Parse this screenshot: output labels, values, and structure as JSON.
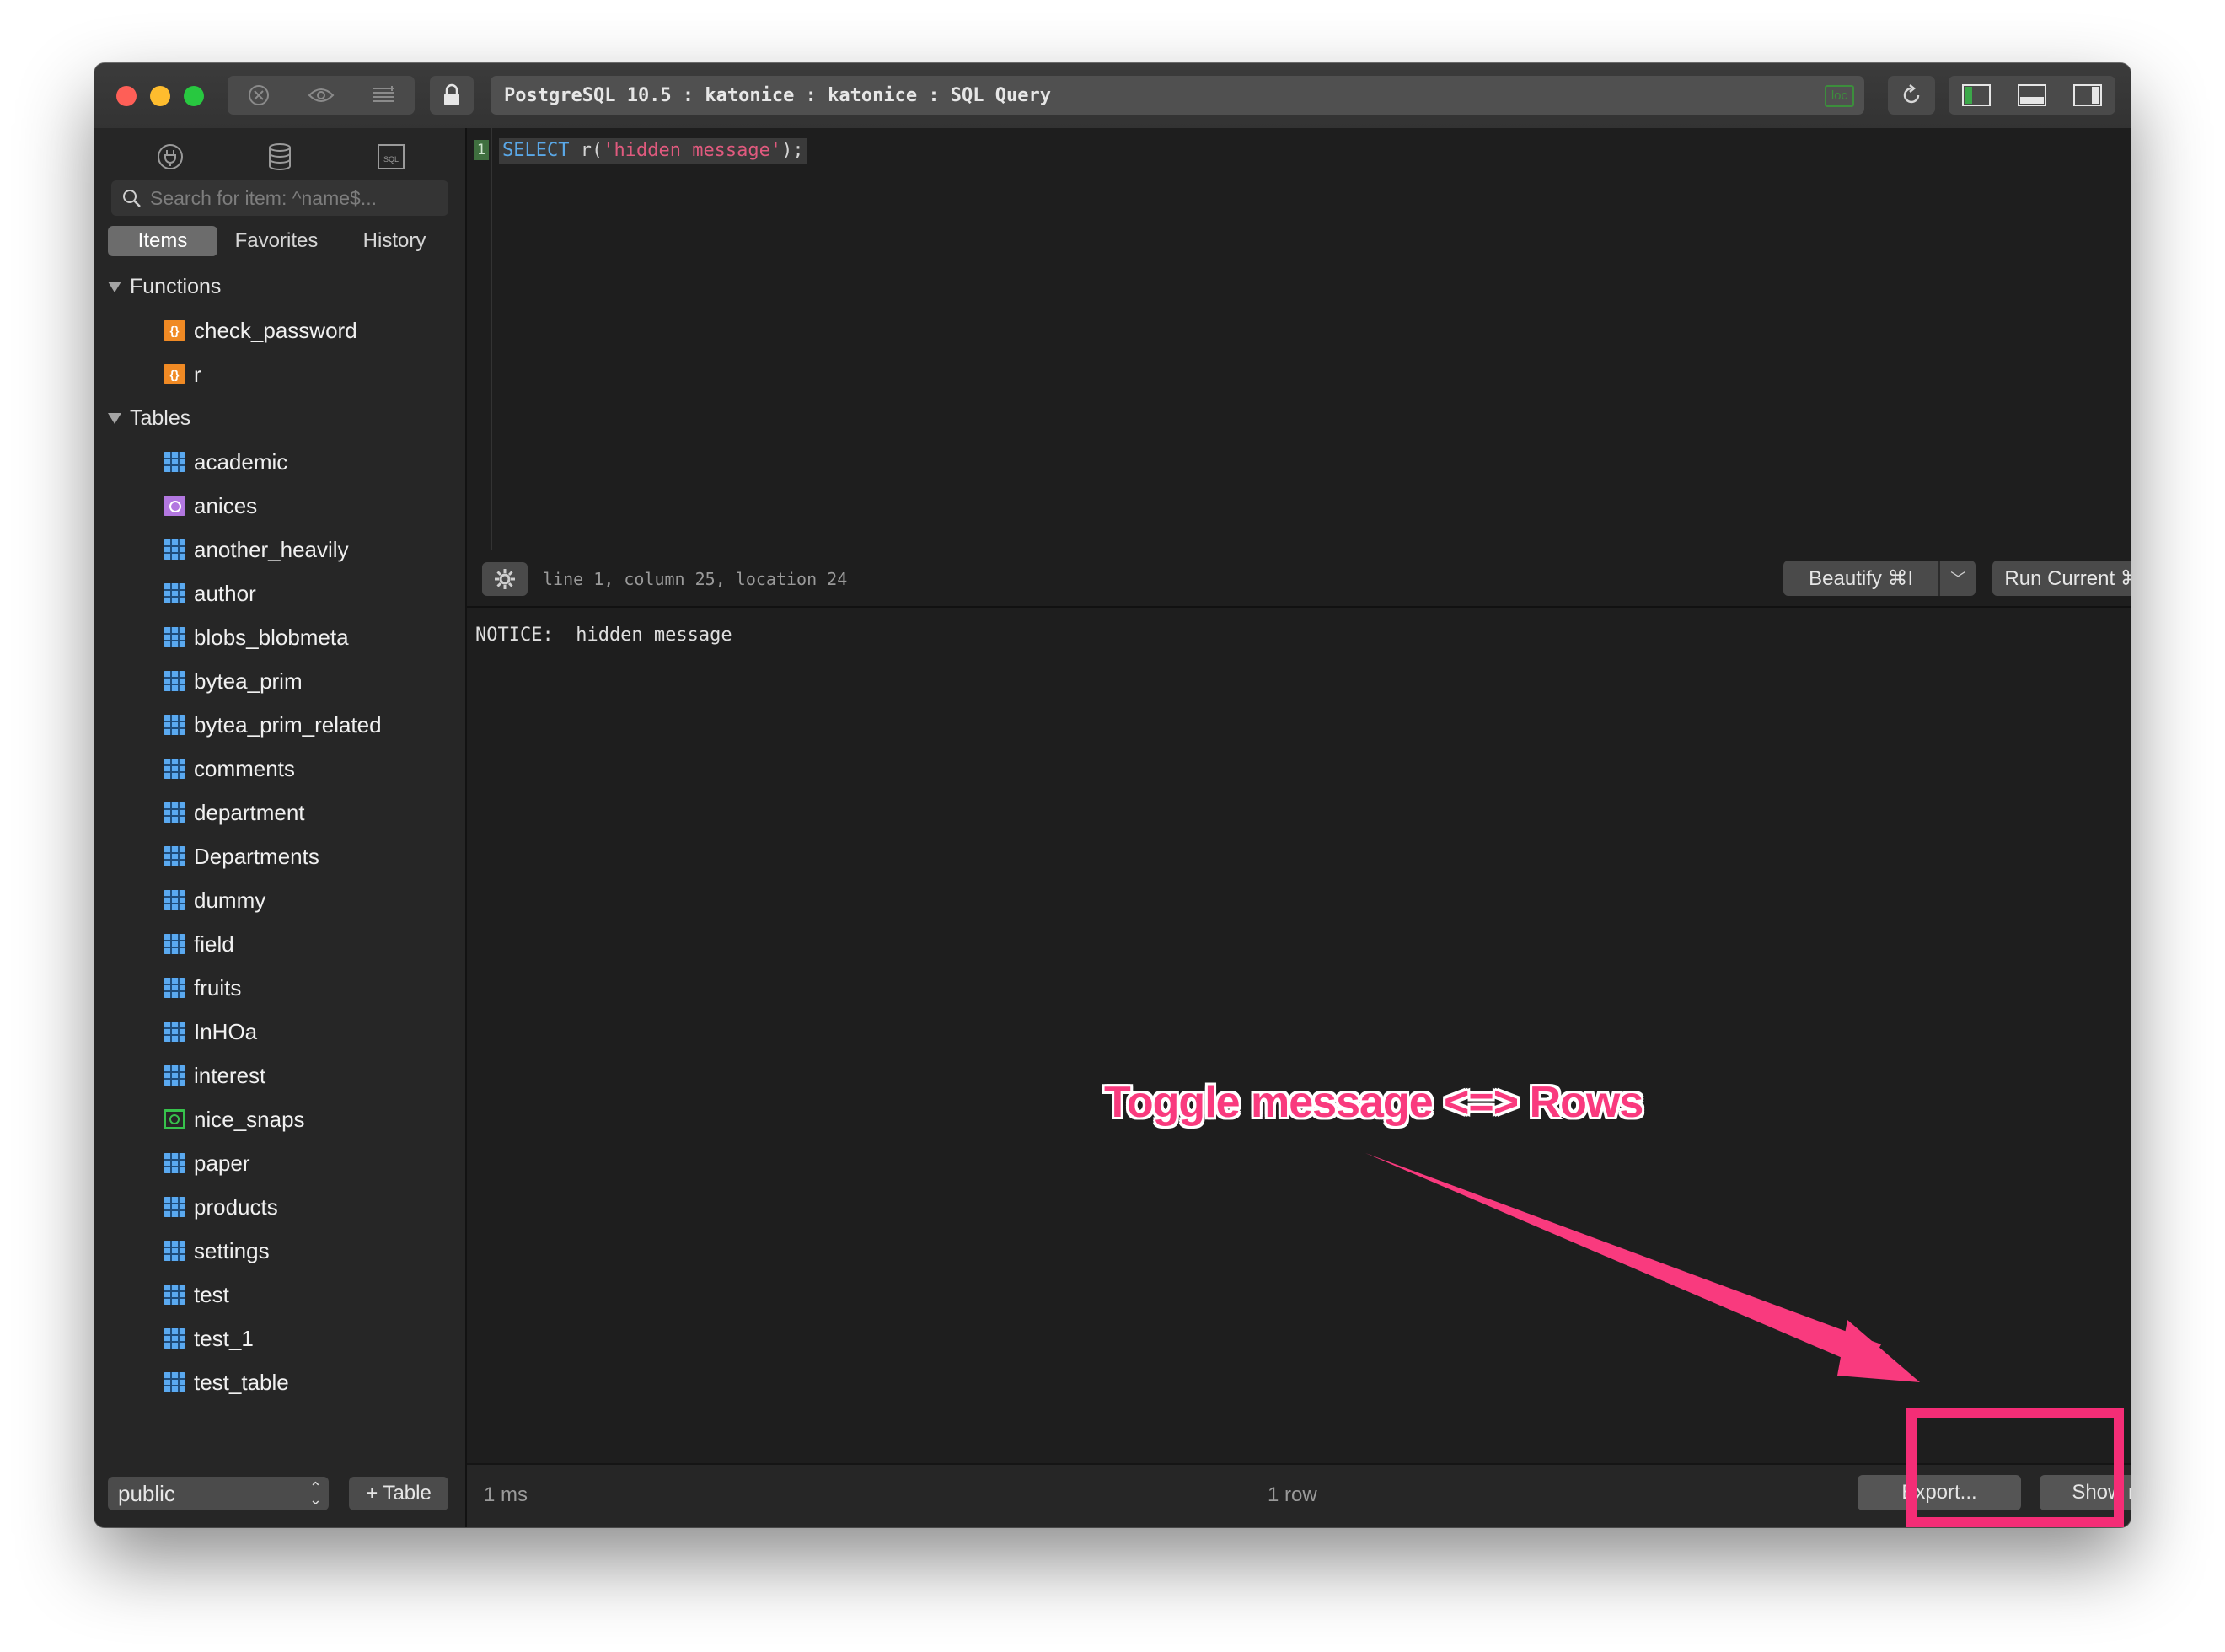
{
  "titlebar": {
    "title": "PostgreSQL 10.5 : katonice : katonice : SQL Query",
    "loc_badge": "loc",
    "nav_icons": [
      "close-circle-icon",
      "eye-icon",
      "list-icon"
    ],
    "layout_icons": [
      "left-panel-icon",
      "bottom-panel-icon",
      "right-panel-icon"
    ]
  },
  "sidebar": {
    "top_icons": [
      "plug-icon",
      "database-icon",
      "sql-icon"
    ],
    "search_placeholder": "Search for item: ^name$...",
    "tabs": [
      {
        "label": "Items",
        "active": true
      },
      {
        "label": "Favorites",
        "active": false
      },
      {
        "label": "History",
        "active": false
      }
    ],
    "groups": [
      {
        "label": "Functions",
        "items": [
          {
            "label": "check_password",
            "kind": "function"
          },
          {
            "label": "r",
            "kind": "function"
          }
        ]
      },
      {
        "label": "Tables",
        "items": [
          {
            "label": "academic",
            "kind": "table"
          },
          {
            "label": "anices",
            "kind": "view"
          },
          {
            "label": "another_heavily",
            "kind": "table"
          },
          {
            "label": "author",
            "kind": "table"
          },
          {
            "label": "blobs_blobmeta",
            "kind": "table"
          },
          {
            "label": "bytea_prim",
            "kind": "table"
          },
          {
            "label": "bytea_prim_related",
            "kind": "table"
          },
          {
            "label": "comments",
            "kind": "table"
          },
          {
            "label": "department",
            "kind": "table"
          },
          {
            "label": "Departments",
            "kind": "table"
          },
          {
            "label": "dummy",
            "kind": "table"
          },
          {
            "label": "field",
            "kind": "table"
          },
          {
            "label": "fruits",
            "kind": "table"
          },
          {
            "label": "InHOa",
            "kind": "table"
          },
          {
            "label": "interest",
            "kind": "table"
          },
          {
            "label": "nice_snaps",
            "kind": "matview"
          },
          {
            "label": "paper",
            "kind": "table"
          },
          {
            "label": "products",
            "kind": "table"
          },
          {
            "label": "settings",
            "kind": "table"
          },
          {
            "label": "test",
            "kind": "table"
          },
          {
            "label": "test_1",
            "kind": "table"
          },
          {
            "label": "test_table",
            "kind": "table"
          }
        ]
      }
    ],
    "schema_value": "public",
    "add_table_label": "+ Table"
  },
  "editor": {
    "line_number": "1",
    "code_keyword": "SELECT",
    "code_pre": " r(",
    "code_string": "'hidden message'",
    "code_post": ");",
    "cursor_info": "line 1, column 25, location 24",
    "beautify_label": "Beautify ⌘I",
    "run_label": "Run Current ⌘↵"
  },
  "results": {
    "notice": "NOTICE:  hidden message"
  },
  "bottombar": {
    "duration": "1 ms",
    "row_count": "1 row",
    "export_label": "Export...",
    "show_rows_label": "Show rows"
  },
  "annotation": {
    "text": "Toggle message <=> Rows",
    "color": "#f93a7e"
  }
}
